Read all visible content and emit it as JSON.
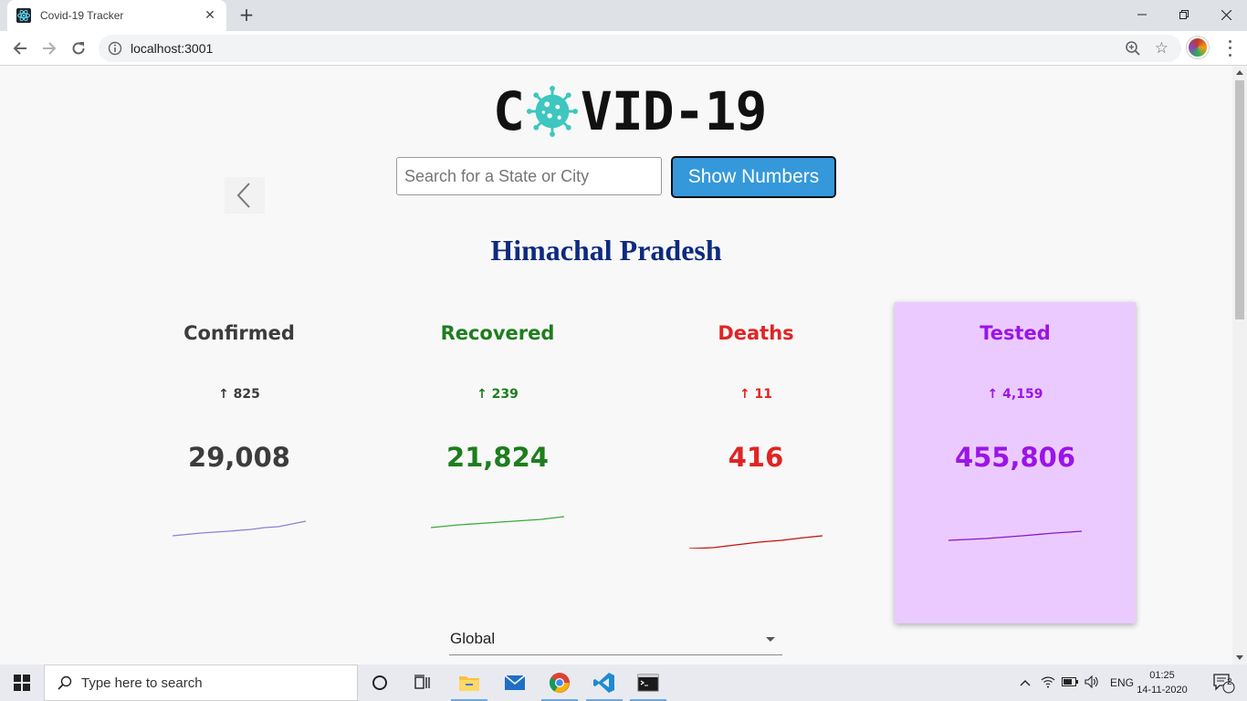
{
  "browser": {
    "tab_title": "Covid-19 Tracker",
    "url": "localhost:3001"
  },
  "page": {
    "logo_text_start": "C",
    "logo_text_end": "VID-19",
    "search_placeholder": "Search for a State or City",
    "show_button_label": "Show Numbers",
    "region_title": "Himachal Pradesh",
    "dropdown_value": "Global"
  },
  "stats": [
    {
      "label": "Confirmed",
      "delta": "↑ 825",
      "total": "29,008",
      "color": "#3c3c3c",
      "spark_color": "#8f7fd6"
    },
    {
      "label": "Recovered",
      "delta": "↑ 239",
      "total": "21,824",
      "color": "#1e7d1e",
      "spark_color": "#3caa3c"
    },
    {
      "label": "Deaths",
      "delta": "↑ 11",
      "total": "416",
      "color": "#e02424",
      "spark_color": "#c80f0f"
    },
    {
      "label": "Tested",
      "delta": "↑ 4,159",
      "total": "455,806",
      "color": "#9b14e6",
      "spark_color": "#8a14d6"
    }
  ],
  "taskbar": {
    "search_placeholder": "Type here to search",
    "language": "ENG",
    "time": "01:25",
    "date": "14-11-2020",
    "notification_count": "2"
  }
}
